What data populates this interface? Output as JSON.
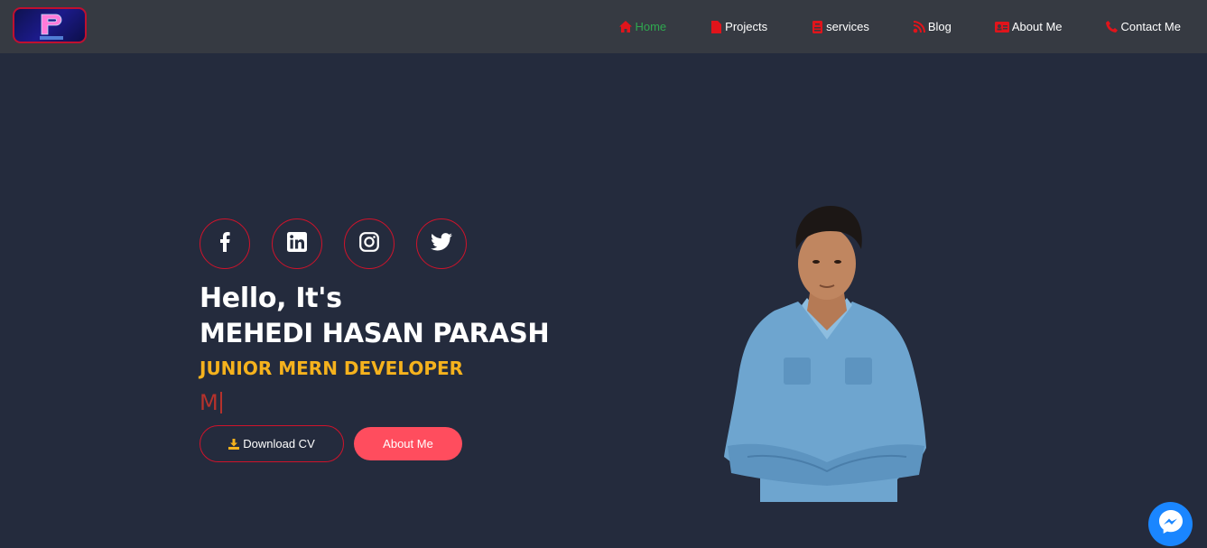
{
  "header": {
    "logo_alt": "P M.H",
    "nav": [
      {
        "label": "Home",
        "icon": "home-icon",
        "active": true
      },
      {
        "label": "Projects",
        "icon": "file-icon",
        "active": false
      },
      {
        "label": "services",
        "icon": "id-badge-icon",
        "active": false
      },
      {
        "label": "Blog",
        "icon": "blog-icon",
        "active": false
      },
      {
        "label": "About Me",
        "icon": "id-card-icon",
        "active": false
      },
      {
        "label": "Contact Me",
        "icon": "phone-icon",
        "active": false
      }
    ]
  },
  "hero": {
    "socials": [
      "facebook-icon",
      "linkedin-icon",
      "instagram-icon",
      "twitter-icon"
    ],
    "greeting": "Hello, It's",
    "name": "MEHEDI HASAN PARASH",
    "role": "JUNIOR MERN DEVELOPER",
    "typed_text": "M",
    "download_cv_label": "Download CV",
    "about_me_label": "About Me"
  },
  "colors": {
    "background": "#242b3d",
    "navbar": "#363a42",
    "accent_red": "#d0132b",
    "active_nav": "#2fa84f",
    "role_yellow": "#f5b21d",
    "about_button": "#ff4d5e",
    "messenger_blue": "#1a86ff"
  }
}
